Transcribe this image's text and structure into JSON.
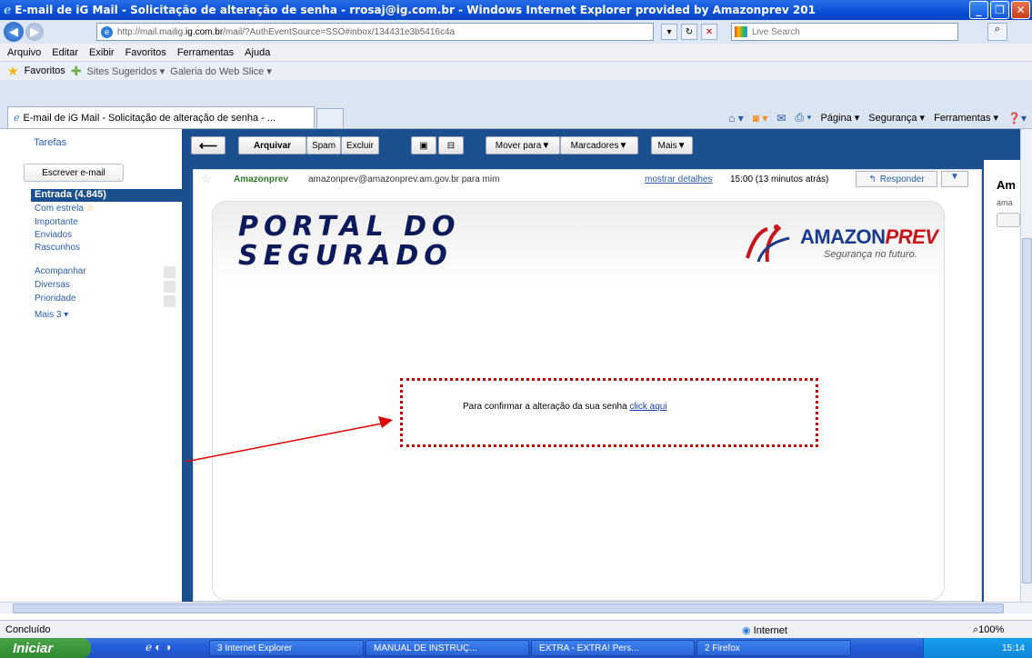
{
  "window": {
    "title": "E-mail de iG Mail - Solicitação de alteração de senha - rrosaj@ig.com.br - Windows Internet Explorer provided by Amazonprev 201"
  },
  "address_bar": {
    "url_prefix": "http://mail.mailig.",
    "url_domain": "ig.com.br",
    "url_suffix": "/mail/?AuthEventSource=SSO#inbox/134431e3b5416c4a",
    "search_placeholder": "Live Search"
  },
  "menu": [
    "Arquivo",
    "Editar",
    "Exibir",
    "Favoritos",
    "Ferramentas",
    "Ajuda"
  ],
  "favorites_bar": {
    "favorites_label": "Favoritos",
    "sites_label": "Sites Sugeridos ▾",
    "slice_label": "Galeria do Web Slice ▾"
  },
  "tab": {
    "title": "E-mail de iG Mail - Solicitação de alteração de senha - ..."
  },
  "command_bar": [
    "Página ▾",
    "Segurança ▾",
    "Ferramentas ▾"
  ],
  "left_nav": {
    "tarefas": "Tarefas",
    "compose": "Escrever e-mail",
    "inbox": "Entrada (4.845)",
    "links": [
      "Com estrela",
      "Importante",
      "Enviados",
      "Rascunhos"
    ],
    "labels": [
      "Acompanhar",
      "Diversas",
      "Prioridade"
    ],
    "more": "Mais 3 ▾"
  },
  "toolbar": {
    "archive": "Arquivar",
    "spam": "Spam",
    "delete": "Excluir",
    "move": "Mover para▼",
    "labels": "Marcadores▼",
    "more": "Mais▼"
  },
  "message": {
    "sender_name": "Amazonprev",
    "sender_email": "amazonprev@amazonprev.am.gov.br",
    "to": "para mim",
    "details": "mostrar detalhes",
    "time": "15:00 (13 minutos atrás)",
    "reply": "Responder",
    "portal_line1": "PORTAL DO",
    "portal_line2": "SEGURADO",
    "brand_a": "AMAZON",
    "brand_b": "PREV",
    "brand_tagline": "Segurança no futuro.",
    "body_text": "Para confirmar a alteração da sua senha",
    "body_link": "click aqui"
  },
  "right_pane": {
    "name": "Am",
    "email": "ama"
  },
  "status_bar": {
    "left": "Concluído",
    "zone": "Internet",
    "zoom": "100%"
  },
  "taskbar": {
    "start": "Iniciar",
    "tasks": [
      "3 Internet Explorer",
      "MANUAL DE INSTRUÇ...",
      "EXTRA - EXTRA! Pers...",
      "2 Firefox"
    ],
    "clock": "15:14"
  },
  "colors": {
    "titlebar": "#0a4fd6",
    "gmail_blue": "#1c4f8e",
    "sender_green": "#2d7d2b",
    "annotation_red": "#c40000"
  }
}
